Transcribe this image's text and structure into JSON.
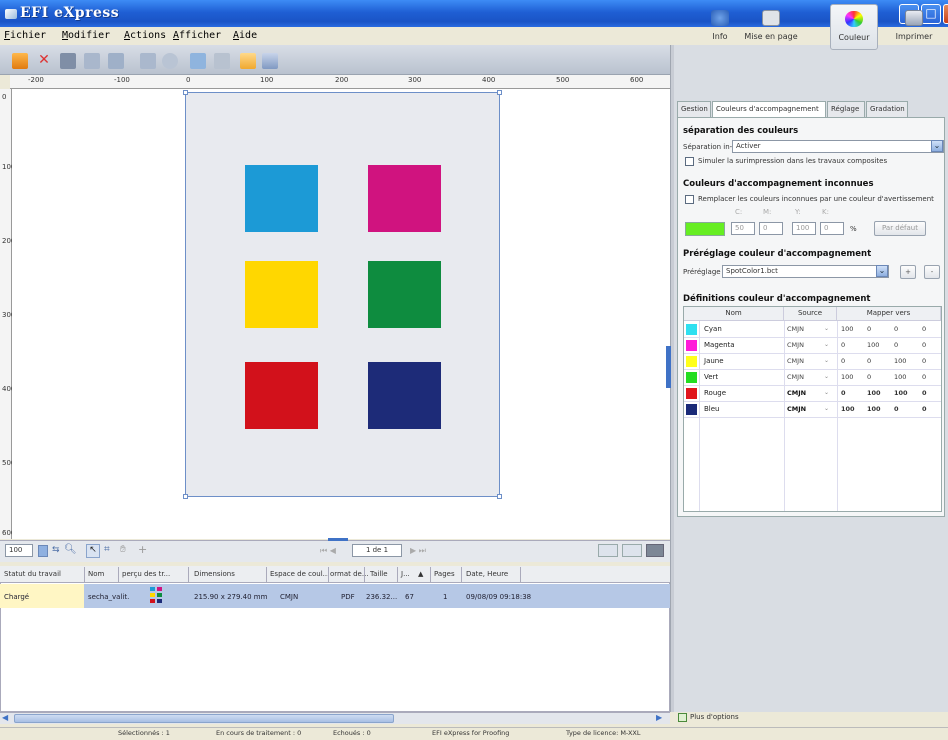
{
  "window": {
    "title": "EFI eXpress"
  },
  "menu": [
    "Fichier",
    "Modifier",
    "Actions",
    "Afficher",
    "Aide"
  ],
  "ruler": {
    "h_labels": [
      "-200",
      "-100",
      "0",
      "100",
      "200",
      "300",
      "400",
      "500",
      "600"
    ],
    "v_labels": [
      "0",
      "100",
      "200",
      "300",
      "400",
      "500",
      "600"
    ]
  },
  "canvas": {
    "swatches": [
      {
        "name": "cyan",
        "color": "#1c9ad6"
      },
      {
        "name": "magenta",
        "color": "#d0137f"
      },
      {
        "name": "yellow",
        "color": "#ffd700"
      },
      {
        "name": "green",
        "color": "#0e8c3f"
      },
      {
        "name": "red",
        "color": "#d2111b"
      },
      {
        "name": "blue",
        "color": "#1d2b78"
      }
    ]
  },
  "navbar": {
    "zoom": "100",
    "page_indicator": "1 de 1"
  },
  "right_tabs": [
    {
      "label": "Info",
      "icon": "info-icon"
    },
    {
      "label": "Mise en page",
      "icon": "layout-icon"
    },
    {
      "label": "Couleur",
      "icon": "color-wheel-icon"
    },
    {
      "label": "Imprimer",
      "icon": "printer-icon"
    }
  ],
  "subtabs": [
    "Gestion",
    "Couleurs d'accompagnement",
    "Réglage",
    "Gradation"
  ],
  "separation": {
    "heading": "séparation des couleurs",
    "rip_label": "Séparation in-RIP :",
    "rip_value": "Activer",
    "simulate_label": "Simuler la surimpression dans les travaux composites"
  },
  "unknown": {
    "heading": "Couleurs d'accompagnement inconnues",
    "replace_label": "Remplacer les couleurs inconnues par une couleur d'avertissement",
    "channels": [
      "C:",
      "M:",
      "Y:",
      "K:"
    ],
    "values": [
      "50",
      "0",
      "100",
      "0"
    ],
    "percent": "%",
    "default_button": "Par défaut",
    "warning_color": "#66ee22"
  },
  "preset": {
    "heading": "Préréglage couleur d'accompagnement",
    "label": "Préréglage :",
    "value": "SpotColor1.bct",
    "add": "+",
    "remove": "-"
  },
  "definitions": {
    "heading": "Définitions couleur d'accompagnement",
    "columns": [
      "Nom",
      "Source",
      "Mapper vers"
    ],
    "rows": [
      {
        "color": "#2fe0f0",
        "name": "Cyan",
        "source": "CMJN",
        "c": "100",
        "m": "0",
        "y": "0",
        "k": "0"
      },
      {
        "color": "#ff1ad9",
        "name": "Magenta",
        "source": "CMJN",
        "c": "0",
        "m": "100",
        "y": "0",
        "k": "0"
      },
      {
        "color": "#ffff1a",
        "name": "Jaune",
        "source": "CMJN",
        "c": "0",
        "m": "0",
        "y": "100",
        "k": "0"
      },
      {
        "color": "#22dd22",
        "name": "Vert",
        "source": "CMJN",
        "c": "100",
        "m": "0",
        "y": "100",
        "k": "0"
      },
      {
        "color": "#e0141c",
        "name": "Rouge",
        "source": "CMJN",
        "c": "0",
        "m": "100",
        "y": "100",
        "k": "0"
      },
      {
        "color": "#1a2a78",
        "name": "Bleu",
        "source": "CMJN",
        "c": "100",
        "m": "100",
        "y": "0",
        "k": "0"
      }
    ]
  },
  "more_options": "Plus d'options",
  "jobs": {
    "columns": [
      "Statut du travail",
      "Nom",
      "perçu des tr...",
      "Dimensions",
      "Espace de coul...",
      "ormat de...",
      "Taille",
      "J...",
      "Pages",
      "Date, Heure"
    ],
    "row": {
      "status": "Chargé",
      "name": "secha_valit.",
      "dimensions": "215.90 x 279.40 mm",
      "colorspace": "CMJN",
      "format": "PDF",
      "size": "236.32...",
      "j": "67",
      "pages": "1",
      "date": "09/08/09 09:18:38"
    }
  },
  "status": {
    "selected": "Sélectionnés : 1",
    "processing": "En cours de traitement : 0",
    "failed": "Echoués : 0",
    "product": "EFI eXpress for Proofing",
    "license": "Type de licence: M-XXL"
  }
}
